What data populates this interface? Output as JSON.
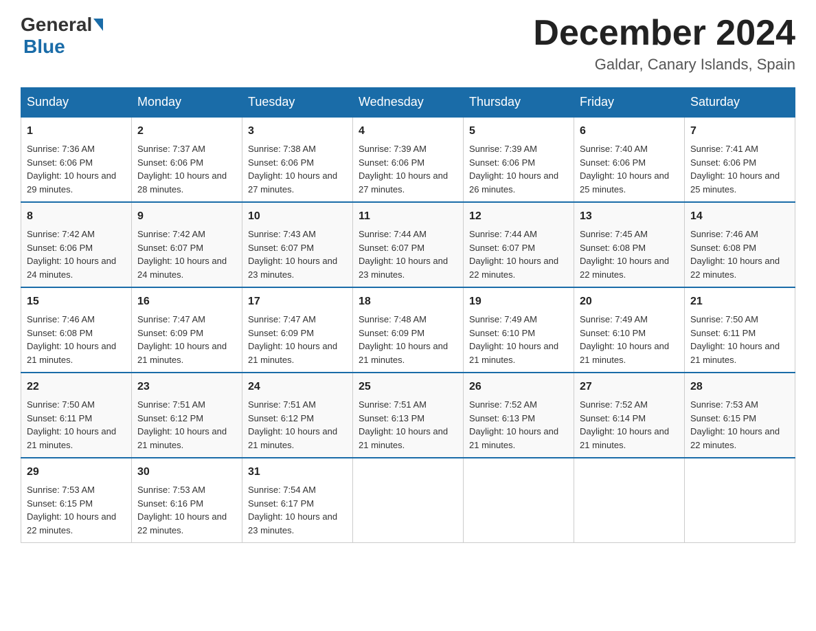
{
  "header": {
    "logo": {
      "general": "General",
      "blue": "Blue"
    },
    "title": "December 2024",
    "location": "Galdar, Canary Islands, Spain"
  },
  "days_of_week": [
    "Sunday",
    "Monday",
    "Tuesday",
    "Wednesday",
    "Thursday",
    "Friday",
    "Saturday"
  ],
  "weeks": [
    [
      {
        "day": 1,
        "sunrise": "7:36 AM",
        "sunset": "6:06 PM",
        "daylight": "10 hours and 29 minutes."
      },
      {
        "day": 2,
        "sunrise": "7:37 AM",
        "sunset": "6:06 PM",
        "daylight": "10 hours and 28 minutes."
      },
      {
        "day": 3,
        "sunrise": "7:38 AM",
        "sunset": "6:06 PM",
        "daylight": "10 hours and 27 minutes."
      },
      {
        "day": 4,
        "sunrise": "7:39 AM",
        "sunset": "6:06 PM",
        "daylight": "10 hours and 27 minutes."
      },
      {
        "day": 5,
        "sunrise": "7:39 AM",
        "sunset": "6:06 PM",
        "daylight": "10 hours and 26 minutes."
      },
      {
        "day": 6,
        "sunrise": "7:40 AM",
        "sunset": "6:06 PM",
        "daylight": "10 hours and 25 minutes."
      },
      {
        "day": 7,
        "sunrise": "7:41 AM",
        "sunset": "6:06 PM",
        "daylight": "10 hours and 25 minutes."
      }
    ],
    [
      {
        "day": 8,
        "sunrise": "7:42 AM",
        "sunset": "6:06 PM",
        "daylight": "10 hours and 24 minutes."
      },
      {
        "day": 9,
        "sunrise": "7:42 AM",
        "sunset": "6:07 PM",
        "daylight": "10 hours and 24 minutes."
      },
      {
        "day": 10,
        "sunrise": "7:43 AM",
        "sunset": "6:07 PM",
        "daylight": "10 hours and 23 minutes."
      },
      {
        "day": 11,
        "sunrise": "7:44 AM",
        "sunset": "6:07 PM",
        "daylight": "10 hours and 23 minutes."
      },
      {
        "day": 12,
        "sunrise": "7:44 AM",
        "sunset": "6:07 PM",
        "daylight": "10 hours and 22 minutes."
      },
      {
        "day": 13,
        "sunrise": "7:45 AM",
        "sunset": "6:08 PM",
        "daylight": "10 hours and 22 minutes."
      },
      {
        "day": 14,
        "sunrise": "7:46 AM",
        "sunset": "6:08 PM",
        "daylight": "10 hours and 22 minutes."
      }
    ],
    [
      {
        "day": 15,
        "sunrise": "7:46 AM",
        "sunset": "6:08 PM",
        "daylight": "10 hours and 21 minutes."
      },
      {
        "day": 16,
        "sunrise": "7:47 AM",
        "sunset": "6:09 PM",
        "daylight": "10 hours and 21 minutes."
      },
      {
        "day": 17,
        "sunrise": "7:47 AM",
        "sunset": "6:09 PM",
        "daylight": "10 hours and 21 minutes."
      },
      {
        "day": 18,
        "sunrise": "7:48 AM",
        "sunset": "6:09 PM",
        "daylight": "10 hours and 21 minutes."
      },
      {
        "day": 19,
        "sunrise": "7:49 AM",
        "sunset": "6:10 PM",
        "daylight": "10 hours and 21 minutes."
      },
      {
        "day": 20,
        "sunrise": "7:49 AM",
        "sunset": "6:10 PM",
        "daylight": "10 hours and 21 minutes."
      },
      {
        "day": 21,
        "sunrise": "7:50 AM",
        "sunset": "6:11 PM",
        "daylight": "10 hours and 21 minutes."
      }
    ],
    [
      {
        "day": 22,
        "sunrise": "7:50 AM",
        "sunset": "6:11 PM",
        "daylight": "10 hours and 21 minutes."
      },
      {
        "day": 23,
        "sunrise": "7:51 AM",
        "sunset": "6:12 PM",
        "daylight": "10 hours and 21 minutes."
      },
      {
        "day": 24,
        "sunrise": "7:51 AM",
        "sunset": "6:12 PM",
        "daylight": "10 hours and 21 minutes."
      },
      {
        "day": 25,
        "sunrise": "7:51 AM",
        "sunset": "6:13 PM",
        "daylight": "10 hours and 21 minutes."
      },
      {
        "day": 26,
        "sunrise": "7:52 AM",
        "sunset": "6:13 PM",
        "daylight": "10 hours and 21 minutes."
      },
      {
        "day": 27,
        "sunrise": "7:52 AM",
        "sunset": "6:14 PM",
        "daylight": "10 hours and 21 minutes."
      },
      {
        "day": 28,
        "sunrise": "7:53 AM",
        "sunset": "6:15 PM",
        "daylight": "10 hours and 22 minutes."
      }
    ],
    [
      {
        "day": 29,
        "sunrise": "7:53 AM",
        "sunset": "6:15 PM",
        "daylight": "10 hours and 22 minutes."
      },
      {
        "day": 30,
        "sunrise": "7:53 AM",
        "sunset": "6:16 PM",
        "daylight": "10 hours and 22 minutes."
      },
      {
        "day": 31,
        "sunrise": "7:54 AM",
        "sunset": "6:17 PM",
        "daylight": "10 hours and 23 minutes."
      },
      null,
      null,
      null,
      null
    ]
  ],
  "labels": {
    "sunrise": "Sunrise:",
    "sunset": "Sunset:",
    "daylight": "Daylight:"
  }
}
